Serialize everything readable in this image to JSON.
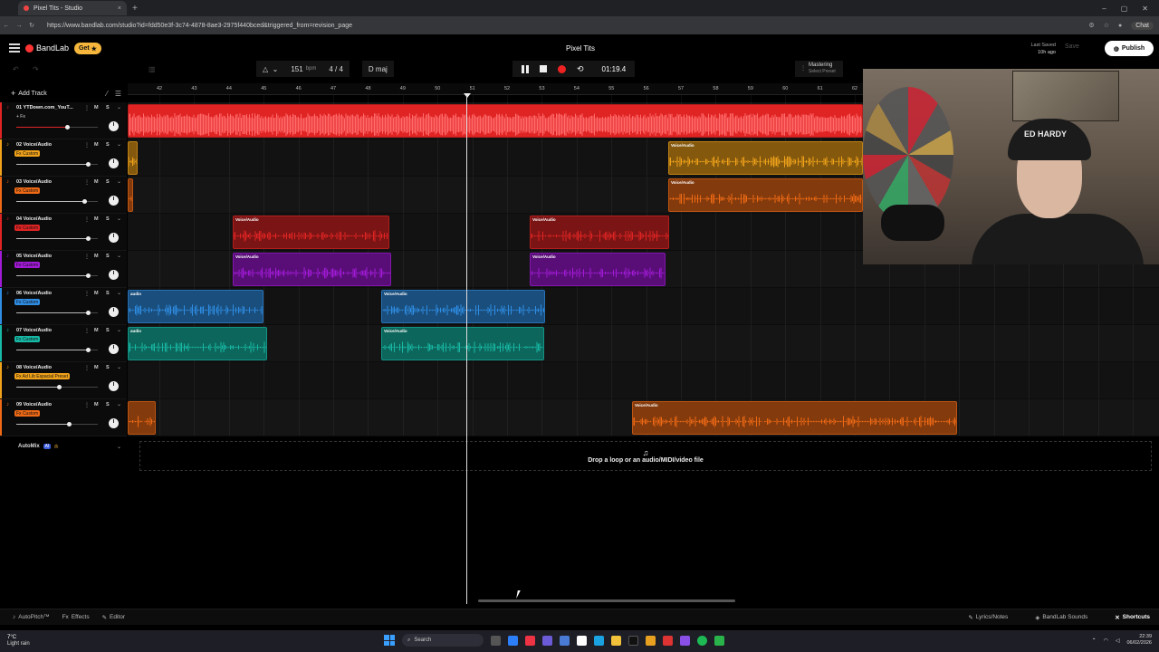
{
  "browser": {
    "tab_title": "Pixel Tits - Studio",
    "url": "https://www.bandlab.com/studio?id=fdd50e3f-3c74-4878-8ae3-2975f440bced&triggered_from=revision_page",
    "chat_label": "Chat"
  },
  "header": {
    "brand": "BandLab",
    "get_label": "Get",
    "project_title": "Pixel Tits",
    "last_saved_label": "Last Saved",
    "last_saved_value": "10h ago",
    "save_label": "Save",
    "publish_label": "Publish"
  },
  "transport": {
    "bpm": "151",
    "bpm_unit": "bpm",
    "time_signature": "4 / 4",
    "key": "D maj",
    "time": "01:19.4",
    "mastering_label": "Mastering",
    "mastering_sub": "Select Preset"
  },
  "left_panel": {
    "add_track_label": "Add Track",
    "automix_label": "AutoMix",
    "automix_badge": "AI"
  },
  "tracks": [
    {
      "name": "01  YTDown.com_YouT...",
      "fx": "+ Fx",
      "color": "#e02424",
      "fx_color": "#222222",
      "mute": "M",
      "solo": "S"
    },
    {
      "name": "02  Voice/Audio",
      "fx": "Fx Custom",
      "color": "#f0a21a",
      "fx_color": "#f0a21a",
      "mute": "M",
      "solo": "S"
    },
    {
      "name": "03  Voice/Audio",
      "fx": "Fx Custom",
      "color": "#ef6a16",
      "fx_color": "#ef6a16",
      "mute": "M",
      "solo": "S"
    },
    {
      "name": "04  Voice/Audio",
      "fx": "Fx Custom",
      "color": "#e02424",
      "fx_color": "#e02424",
      "mute": "M",
      "solo": "S"
    },
    {
      "name": "05  Voice/Audio",
      "fx": "Fx Custom",
      "color": "#a21ad8",
      "fx_color": "#a21ad8",
      "mute": "M",
      "solo": "S"
    },
    {
      "name": "06  Voice/Audio",
      "fx": "Fx Custom",
      "color": "#2f8de4",
      "fx_color": "#2f8de4",
      "mute": "M",
      "solo": "S"
    },
    {
      "name": "07  Voice/Audio",
      "fx": "Fx Custom",
      "color": "#17b9a6",
      "fx_color": "#17b9a6",
      "mute": "M",
      "solo": "S"
    },
    {
      "name": "08  Voice/Audio",
      "fx": "Fx Ad Lib Espacial Preset",
      "color": "#f0a21a",
      "fx_color": "#f0a21a",
      "mute": "M",
      "solo": "S"
    },
    {
      "name": "09  Voice/Audio",
      "fx": "Fx Custom",
      "color": "#ef6a16",
      "fx_color": "#ef6a16",
      "mute": "M",
      "solo": "S"
    }
  ],
  "ruler": [
    "42",
    "43",
    "44",
    "45",
    "46",
    "47",
    "48",
    "49",
    "50",
    "51",
    "52",
    "53",
    "54",
    "55",
    "56",
    "57",
    "58",
    "59",
    "60",
    "61",
    "62"
  ],
  "clip_label": "Voice/Audio",
  "clip_label_short": "audio",
  "dropzone_text": "Drop a loop or an audio/MIDI/video file",
  "footer": {
    "autopitch": "AutoPitch™",
    "effects": "Effects",
    "editor": "Editor",
    "lyrics": "Lyrics/Notes",
    "sounds": "BandLab Sounds",
    "shortcuts": "Shortcuts"
  },
  "webcam": {
    "cap_text": "ED HARDY"
  },
  "taskbar": {
    "temperature": "7°C",
    "weather": "Light rain",
    "search_label": "Search",
    "time": "22:39",
    "date": "06/02/2026"
  }
}
